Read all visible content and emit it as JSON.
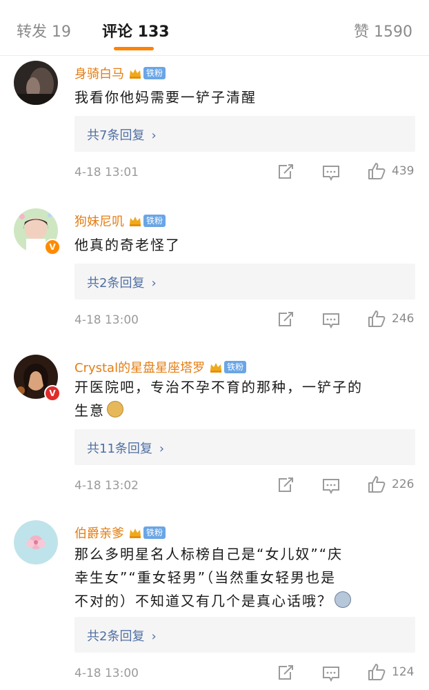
{
  "tabs": {
    "forward_label": "转发 19",
    "comment_label": "评论 133",
    "like_label": "赞 1590"
  },
  "comments": [
    {
      "name": "身骑白马",
      "fan_badge": "铁粉",
      "text_lines": [
        "我看你他妈需要一铲子清醒"
      ],
      "replies": "共7条回复",
      "time": "4-18 13:01",
      "likes": "439"
    },
    {
      "name": "狗妹尼叽",
      "fan_badge": "铁粉",
      "text_lines": [
        "他真的奇老怪了"
      ],
      "replies": "共2条回复",
      "time": "4-18 13:00",
      "likes": "246"
    },
    {
      "name": "Crystal的星盘星座塔罗",
      "fan_badge": "铁粉",
      "text_lines": [
        "开医院吧，专治不孕不育的那种，一铲子的",
        "生意"
      ],
      "replies": "共11条回复",
      "time": "4-18 13:02",
      "likes": "226"
    },
    {
      "name": "伯爵亲爹",
      "fan_badge": "铁粉",
      "text_lines": [
        "那么多明星名人标榜自己是“女儿奴”“庆",
        "幸生女”“重女轻男”（当然重女轻男也是",
        "不对的）不知道又有几个是真心话哦？"
      ],
      "replies": "共2条回复",
      "time": "4-18 13:00",
      "likes": "124"
    }
  ],
  "icons": {
    "share": "share-icon",
    "comment": "comment-icon",
    "like": "thumbs-up-icon",
    "chevron": "chevron-right-icon"
  },
  "colors": {
    "accent": "#ff8200",
    "username": "#e47d12",
    "reply_link": "#4f6fa3",
    "fan_badge": "#6aa5e6"
  }
}
